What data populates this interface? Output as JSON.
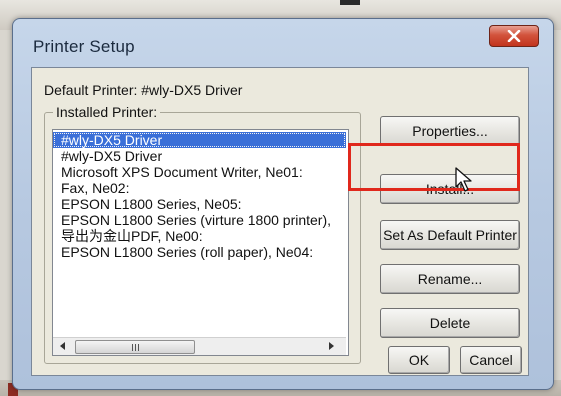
{
  "window": {
    "title": "Printer Setup",
    "close_icon": "close-x-icon"
  },
  "default_printer": {
    "label": "Default Printer: #wly-DX5 Driver"
  },
  "installed": {
    "group_label": "Installed Printer:",
    "items": [
      "#wly-DX5 Driver",
      "#wly-DX5 Driver",
      "Microsoft XPS Document Writer, Ne01:",
      "Fax, Ne02:",
      "EPSON L1800 Series, Ne05:",
      "EPSON L1800 Series (virture 1800 printer),",
      "导出为金山PDF, Ne00:",
      "EPSON L1800 Series (roll paper), Ne04:"
    ],
    "selected_index": 0,
    "scroll_thumb_grip": "iii"
  },
  "buttons": {
    "properties": "Properties...",
    "install": "Install...",
    "set_default": "Set As Default Printer",
    "rename": "Rename...",
    "delete": "Delete",
    "ok": "OK",
    "cancel": "Cancel"
  },
  "annotation": {
    "highlight_color": "#e0281c",
    "highlight_target": "Install..."
  },
  "colors": {
    "selection": "#3a6fd8",
    "close_button": "#c8412a"
  }
}
